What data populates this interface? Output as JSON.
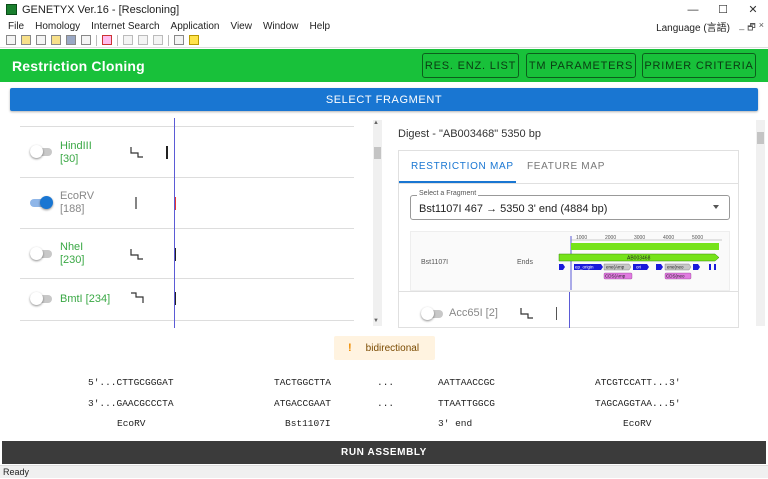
{
  "window": {
    "title": "GENETYX Ver.16 - [Rescloning]",
    "minimize": "—",
    "maximize": "☐",
    "close": "✕"
  },
  "menu": {
    "items": [
      "File",
      "Homology",
      "Internet Search",
      "Application",
      "View",
      "Window",
      "Help"
    ],
    "language": "Language (言語)",
    "mdi": [
      "_",
      "🗗",
      "×"
    ]
  },
  "toolbar": {
    "icons": [
      "new-icon",
      "open-icon",
      "folder-icon",
      "open-folder-icon",
      "save-icon",
      "print-preview-icon",
      "list-icon",
      "cut-icon",
      "copy-icon",
      "paste-icon",
      "print-icon",
      "help-icon"
    ]
  },
  "header": {
    "title": "Restriction Cloning",
    "buttons": [
      "RES. ENZ. LIST",
      "TM PARAMETERS",
      "PRIMER CRITERIA"
    ],
    "color": "#18c13a"
  },
  "select_fragment": "SELECT FRAGMENT",
  "enzymes": [
    {
      "name": "HindIII",
      "count": "[30]",
      "enabled": false
    },
    {
      "name": "EcoRV",
      "count": "[188]",
      "enabled": true
    },
    {
      "name": "NheI",
      "count": "[230]",
      "enabled": false
    },
    {
      "name": "BmtI [234]",
      "enabled": false
    }
  ],
  "right": {
    "digest": "Digest - \"AB003468\" 5350 bp",
    "tabs": [
      "RESTRICTION MAP",
      "FEATURE MAP"
    ],
    "fragment_label": "Select a Fragment",
    "fragment_value": "Bst1107I 467 → 5350 3' end (4884 bp)",
    "map_enzyme": "Bst1107I",
    "map_ends": "Ends",
    "map_ticks": [
      "1000",
      "2000",
      "3000",
      "4000",
      "5000"
    ],
    "map_seq": "AB003468",
    "map_features": [
      "ep_origin",
      "ene(Amp",
      "ori",
      "ene(neo",
      "CDS(Amp",
      "CDS(neo"
    ],
    "acc": {
      "name": "Acc65I [2]",
      "enabled": false
    }
  },
  "notice": {
    "icon": "!",
    "text": "bidirectional"
  },
  "sequences": {
    "top": [
      "5'...CTTGCGGGAT",
      "TACTGGCTTA",
      "...",
      "AATTAACCGC",
      "ATCGTCCATT...3'"
    ],
    "bottom": [
      "3'...GAACGCCCTA",
      "ATGACCGAAT",
      "...",
      "TTAATTGGCG",
      "TAGCAGGTAA...5'"
    ],
    "labels": [
      "EcoRV",
      "Bst1107I",
      "3' end",
      "EcoRV"
    ]
  },
  "run_button": "RUN ASSEMBLY",
  "status": "Ready"
}
